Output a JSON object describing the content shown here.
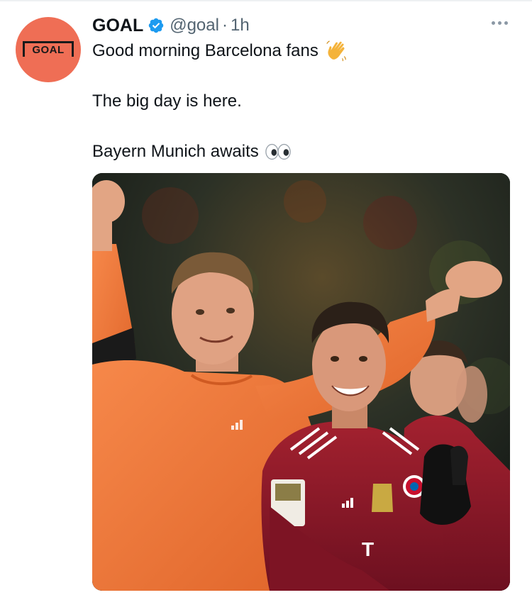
{
  "tweet": {
    "author_name": "GOAL",
    "handle": "@goal",
    "separator": "·",
    "time": "1h",
    "avatar_text": "GOAL",
    "lines": [
      "Good morning Barcelona fans",
      "The big day is here.",
      "Bayern Munich awaits"
    ],
    "emojis": [
      "waving-hand",
      "eyes"
    ]
  },
  "colors": {
    "avatar_bg": "#ef6e55",
    "verified_blue": "#1d9bf0",
    "secondary_text": "#536471",
    "keeper_orange": "#f07d3a",
    "bayern_red": "#9b1a2c"
  },
  "media": {
    "shirt_text": "T"
  }
}
